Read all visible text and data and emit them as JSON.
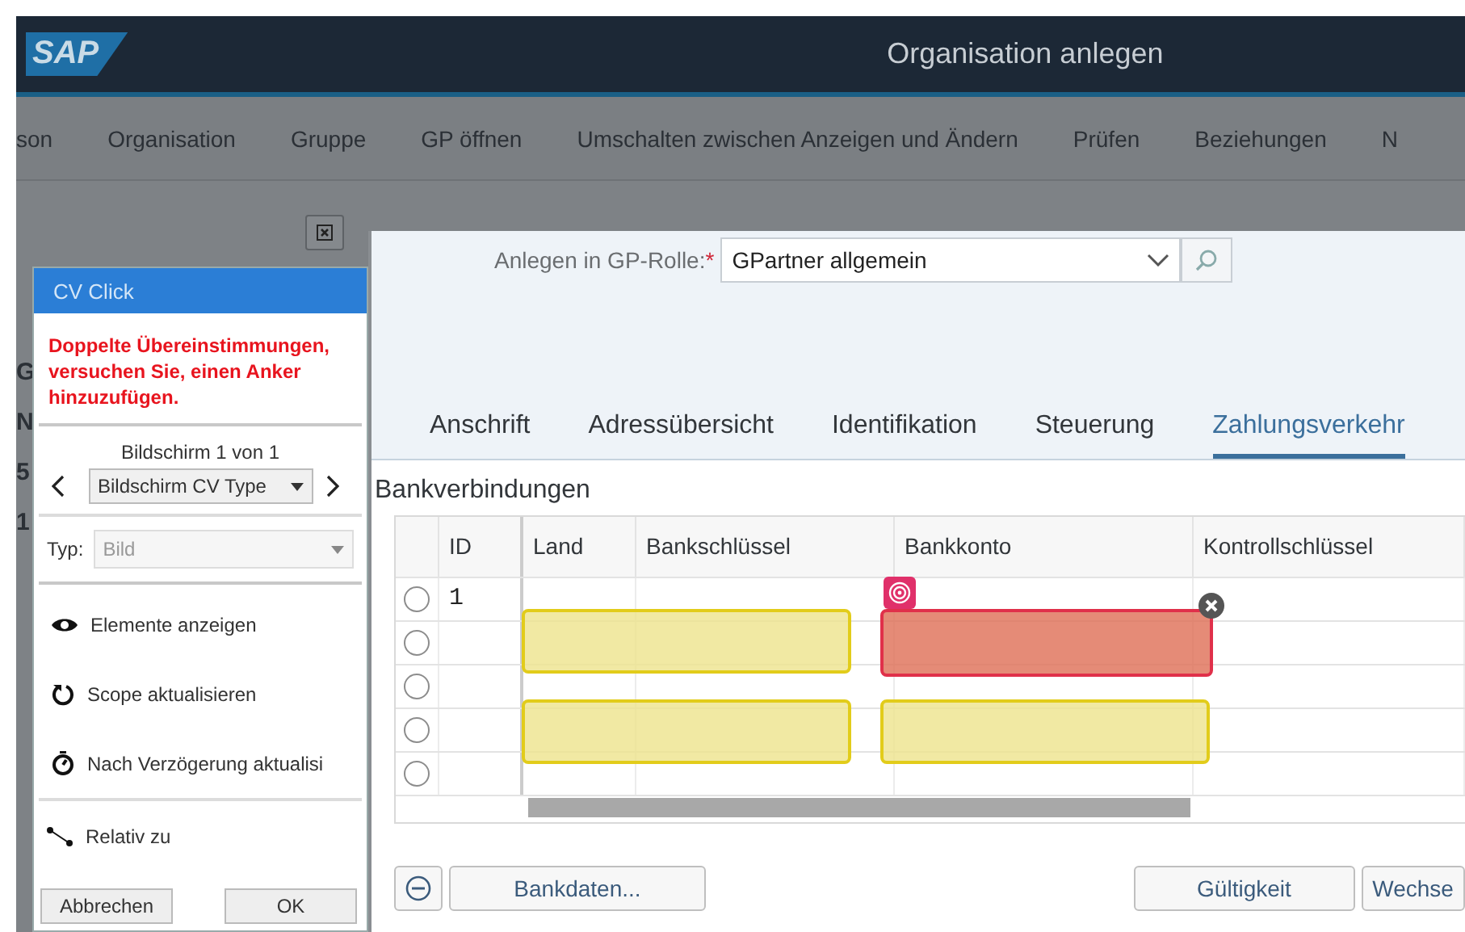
{
  "header": {
    "logo": "SAP",
    "title": "Organisation anlegen"
  },
  "toolbar": [
    "son",
    "Organisation",
    "Gruppe",
    "GP öffnen",
    "Umschalten zwischen Anzeigen und Ändern",
    "Prüfen",
    "Beziehungen",
    "N"
  ],
  "background_fragments": [
    "G",
    "N",
    "5",
    "1"
  ],
  "dialog": {
    "role_label": "Anlegen in GP-Rolle:",
    "required_mark": "*",
    "role_value": "GPartner allgemein",
    "tabs": [
      {
        "label": "Anschrift",
        "selected": false
      },
      {
        "label": "Adressübersicht",
        "selected": false
      },
      {
        "label": "Identifikation",
        "selected": false
      },
      {
        "label": "Steuerung",
        "selected": false
      },
      {
        "label": "Zahlungsverkehr",
        "selected": true
      }
    ],
    "section_title": "Bankverbindungen",
    "table": {
      "columns": [
        "ID",
        "Land",
        "Bankschlüssel",
        "Bankkonto",
        "Kontrollschlüssel"
      ],
      "rows": [
        {
          "id": "1",
          "selected": false
        },
        {
          "selected": false
        },
        {
          "selected": false
        },
        {
          "selected": false
        },
        {
          "selected": false
        }
      ]
    },
    "highlights": [
      {
        "kind": "candidate"
      },
      {
        "kind": "error"
      },
      {
        "kind": "candidate"
      },
      {
        "kind": "candidate"
      }
    ],
    "buttons": [
      {
        "kind": "remove"
      },
      {
        "kind": "text",
        "label": "Bankdaten..."
      },
      {
        "kind": "text",
        "label": "Gültigkeit"
      },
      {
        "kind": "text",
        "label": "Wechse"
      }
    ]
  },
  "cv_panel": {
    "title": "CV Click",
    "error": "Doppelte Übereinstimmungen, versuchen Sie, einen Anker hinzuzufügen.",
    "screen_counter": "Bildschirm 1 von 1",
    "screen_select": "Bildschirm CV Type",
    "type_label": "Typ:",
    "type_value": "Bild",
    "type_disabled": true,
    "actions": [
      {
        "kind": "eye",
        "label": "Elemente anzeigen"
      },
      {
        "kind": "refresh",
        "label": "Scope aktualisieren"
      },
      {
        "kind": "timer",
        "label": "Nach Verzögerung aktualisi"
      }
    ],
    "relative": {
      "label": "Relativ zu"
    },
    "buttons": [
      "Abbrechen",
      "OK"
    ]
  }
}
